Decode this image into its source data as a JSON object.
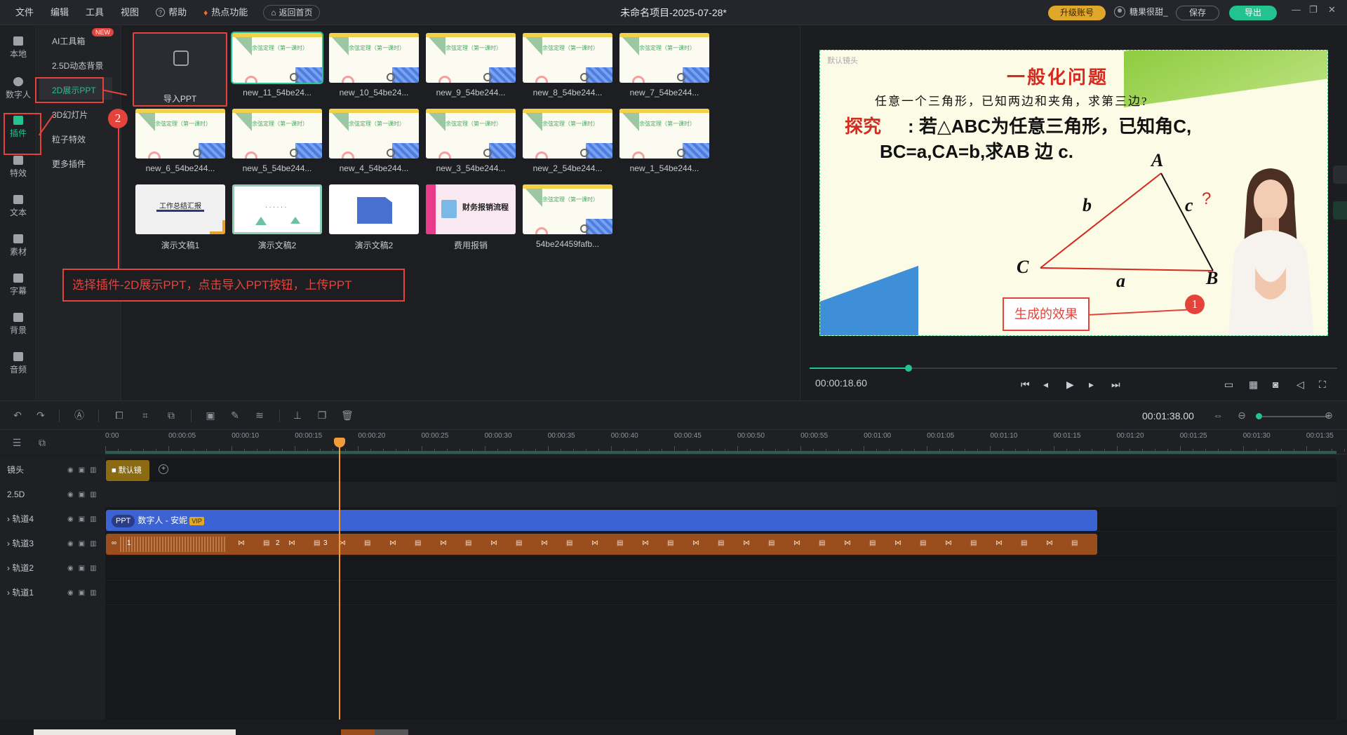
{
  "menu": {
    "file": "文件",
    "edit": "编辑",
    "tools": "工具",
    "view": "视图",
    "help": "帮助",
    "hot": "热点功能",
    "home": "返回首页"
  },
  "title": "未命名项目-2025-07-28*",
  "account": {
    "upgrade": "升级账号",
    "user": "糖果很甜_",
    "save": "保存",
    "export": "导出"
  },
  "rail": [
    {
      "label": "本地",
      "icon": "local-icon"
    },
    {
      "label": "数字人",
      "icon": "avatar-icon"
    },
    {
      "label": "插件",
      "icon": "plugin-icon",
      "active": true
    },
    {
      "label": "特效",
      "icon": "effects-icon"
    },
    {
      "label": "文本",
      "icon": "text-icon"
    },
    {
      "label": "素材",
      "icon": "folder-icon"
    },
    {
      "label": "字幕",
      "icon": "caption-icon"
    },
    {
      "label": "背景",
      "icon": "background-icon"
    },
    {
      "label": "音频",
      "icon": "music-icon"
    }
  ],
  "submenu": {
    "ai": "AI工具箱",
    "new": "NEW",
    "bg25d": "2.5D动态背景",
    "ppt2d": "2D展示PPT",
    "slides3d": "3D幻灯片",
    "particles": "粒子特效",
    "more": "更多插件"
  },
  "grid": {
    "import": "导入PPT",
    "items": [
      "new_11_54be24...",
      "new_10_54be24...",
      "new_9_54be244...",
      "new_8_54be244...",
      "new_7_54be244...",
      "new_6_54be244...",
      "new_5_54be244...",
      "new_4_54be244...",
      "new_3_54be244...",
      "new_2_54be244...",
      "new_1_54be244...",
      "演示文稿1",
      "演示文稿2",
      "演示文稿2",
      "费用报销",
      "54be24459fafb..."
    ]
  },
  "thumbs": {
    "title": "余弦定理（第一课时）",
    "work": "工作总结汇报",
    "finance": "财务报销流程"
  },
  "annotation": {
    "step2": "2",
    "step1": "1",
    "instruction": "选择插件-2D展示PPT，点击导入PPT按钮，上传PPT",
    "effect": "生成的效果"
  },
  "slide": {
    "cam": "默认镜头",
    "title": "一般化问题",
    "line1": "任意一个三角形，已知两边和夹角，求第三边?",
    "explore": "探究",
    "line2": ": 若△ABC为任意三角形，已知角C,",
    "line3": "BC=a,CA=b,求AB 边 c.",
    "A": "A",
    "B": "B",
    "C": "C",
    "a": "a",
    "b": "b",
    "c": "c",
    "q": "?"
  },
  "player": {
    "time": "00:00:18.60",
    "progress": 0.18
  },
  "timeline": {
    "duration": "00:01:38.00",
    "ticks": [
      "0:00",
      "00:00:05",
      "00:00:10",
      "00:00:15",
      "00:00:20",
      "00:00:25",
      "00:00:30",
      "00:00:35",
      "00:00:40",
      "00:00:45",
      "00:00:50",
      "00:00:55",
      "00:01:00",
      "00:01:05",
      "00:01:10",
      "00:01:15",
      "00:01:20",
      "00:01:25",
      "00:01:30",
      "00:01:35"
    ],
    "tracks": [
      "镜头",
      "2.5D",
      "轨道4",
      "轨道3",
      "轨道2",
      "轨道1"
    ],
    "camClip": "默认镜",
    "dhClip": {
      "badge": "PPT",
      "label": "数字人 - 安妮",
      "vip": "VIP"
    },
    "pptClip": {
      "p1": "1",
      "p2": "2",
      "p3": "3"
    }
  },
  "colors": {
    "accent": "#22c38e",
    "red": "#e4433c",
    "gold": "#e0a82a"
  }
}
